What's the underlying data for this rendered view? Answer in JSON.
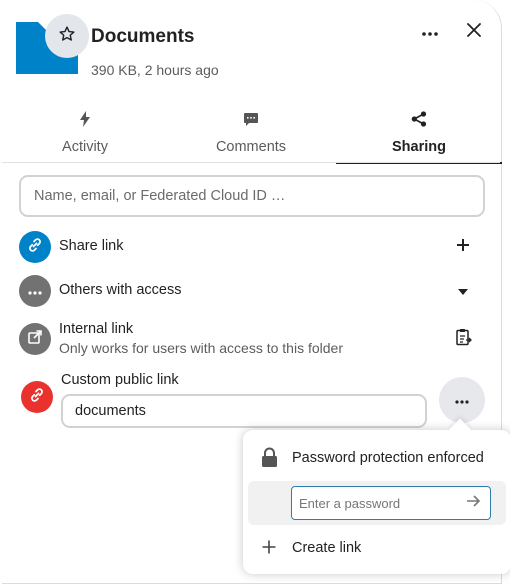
{
  "header": {
    "title": "Documents",
    "subtitle": "390 KB, 2 hours ago",
    "folder_color": "#0082c9"
  },
  "tabs": [
    {
      "label": "Activity",
      "icon": "flash-icon"
    },
    {
      "label": "Comments",
      "icon": "comment-icon"
    },
    {
      "label": "Sharing",
      "icon": "share-icon",
      "active": true
    }
  ],
  "search": {
    "placeholder": "Name, email, or Federated Cloud ID …",
    "value": ""
  },
  "rows": {
    "share_link": {
      "label": "Share link",
      "color": "#0082c9"
    },
    "others": {
      "label": "Others with access",
      "color": "#727272"
    },
    "internal": {
      "label": "Internal link",
      "sublabel": "Only works for users with access to this folder",
      "color": "#727272"
    },
    "custom": {
      "label": "Custom public link",
      "value": "documents",
      "color": "#e9322d"
    }
  },
  "popover": {
    "password_notice": "Password protection enforced",
    "password_placeholder": "Enter a password",
    "create_link": "Create link"
  }
}
